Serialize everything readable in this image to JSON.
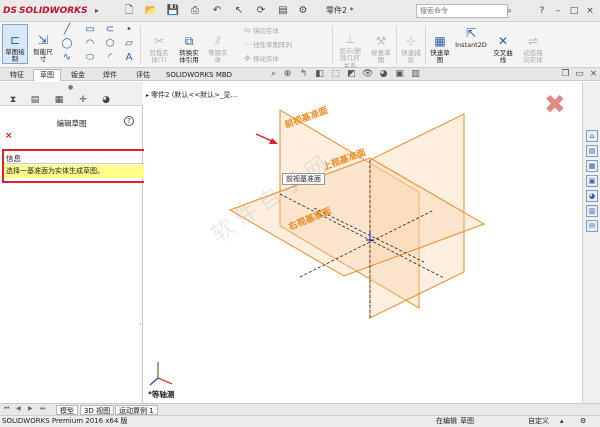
{
  "app": {
    "logo_ds": "DS",
    "logo_text": "SOLIDWORKS",
    "document_title": "零件2 *",
    "search_placeholder": "搜索命令"
  },
  "ribbon": {
    "sketch_exit": "草图绘\n制",
    "smart_dimension": "智能尺\n寸",
    "trim_entities": "剪裁实\n体(T)",
    "convert_entities": "转换实\n体引用",
    "equidistant_entities": "等距实\n体",
    "mirror_entities": "镜向实体",
    "linear_pattern": "线性草图阵列",
    "move_entities": "移动实体",
    "display_relations": "显示/删\n除几何\n关系",
    "repair_sketch": "修复草\n图",
    "quick_snaps": "快速捕\n捉",
    "rapid_sketch": "快速草\n图",
    "instant2d": "Instant2D",
    "intersection_curve": "交叉曲\n线",
    "dynamic_mirror": "动态镜\n向实体"
  },
  "tabs": [
    "特征",
    "草图",
    "钣金",
    "焊件",
    "评估",
    "SOLIDWORKS MBD"
  ],
  "active_tab": "草图",
  "panel": {
    "title": "编辑草图",
    "help": "?",
    "close": "×",
    "info_header": "信息",
    "info_message": "选择一基准面为实体生成草图。"
  },
  "viewport": {
    "tree_item": "零件2 (默认<<默认>_显...",
    "tooltip": "前视基准面",
    "view_label": "*等轴测",
    "watermark": "软件自学网",
    "plane_front": "前视基准面",
    "plane_top": "上视基准面",
    "plane_right": "右视基准面"
  },
  "bottom_tabs": [
    "模型",
    "3D 视图",
    "运动算例 1"
  ],
  "active_bottom_tab": "模型",
  "status": {
    "version": "SOLIDWORKS Premium 2016 x64 版",
    "editing": "在编辑",
    "mode": "草图",
    "units": "自定义"
  },
  "colors": {
    "accent_red": "#e0202a",
    "plane_orange": "#f28a1e",
    "plane_fill": "#fbd2a6",
    "info_yellow": "#ffff8a"
  }
}
